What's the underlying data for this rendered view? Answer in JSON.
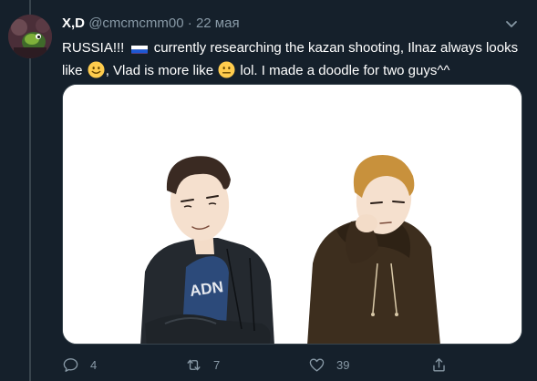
{
  "tweet": {
    "display_name": "X,D",
    "handle": "@cmcmcmm00",
    "separator": "·",
    "date": "22 мая",
    "text": {
      "part1": "RUSSIA!!!",
      "flag": "russia-flag",
      "part2": "currently researching the kazan shooting, Ilnaz always looks like",
      "emoji1": "slightly-smiling-face",
      "part3": ", Vlad is more like",
      "emoji2": "neutral-face",
      "part4": "lol. I made a doodle for two guys^^"
    }
  },
  "media": {
    "shirt_lettering": "ADN"
  },
  "actions": {
    "reply_count": "4",
    "retweet_count": "7",
    "like_count": "39"
  },
  "colors": {
    "background": "#15202b",
    "border": "#38444d",
    "secondary_text": "#8899a6",
    "primary_text": "#ffffff"
  }
}
